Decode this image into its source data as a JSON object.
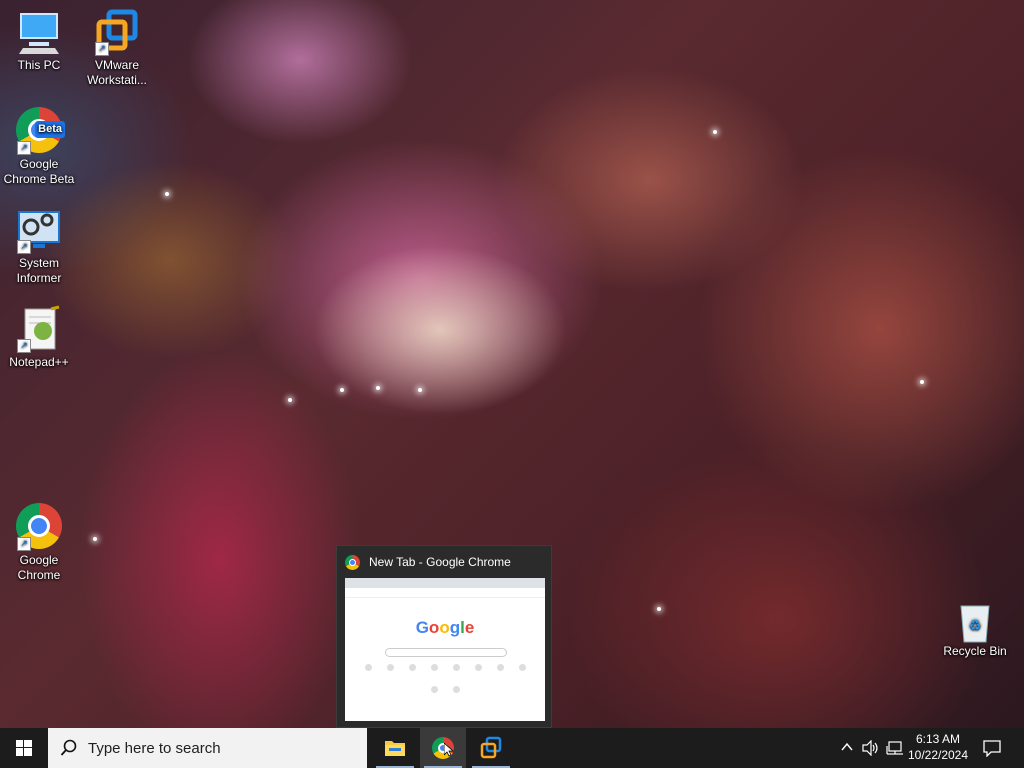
{
  "desktop": {
    "icons": [
      {
        "label": "This PC"
      },
      {
        "label": "VMware Workstati..."
      },
      {
        "label": "Google Chrome Beta",
        "badge": "Beta"
      },
      {
        "label": "System Informer"
      },
      {
        "label": "Notepad++"
      },
      {
        "label": "Google Chrome"
      },
      {
        "label": "Recycle Bin"
      }
    ]
  },
  "preview": {
    "title": "New Tab - Google Chrome",
    "logo": "Google"
  },
  "taskbar": {
    "search_placeholder": "Type here to search",
    "clock": {
      "time": "6:13 AM",
      "date": "10/22/2024"
    },
    "apps": [
      {
        "name": "File Explorer"
      },
      {
        "name": "Google Chrome"
      },
      {
        "name": "VMware Workstation"
      }
    ]
  },
  "colors": {
    "taskbar": "#1c1c1c",
    "accent": "#4285f4"
  }
}
